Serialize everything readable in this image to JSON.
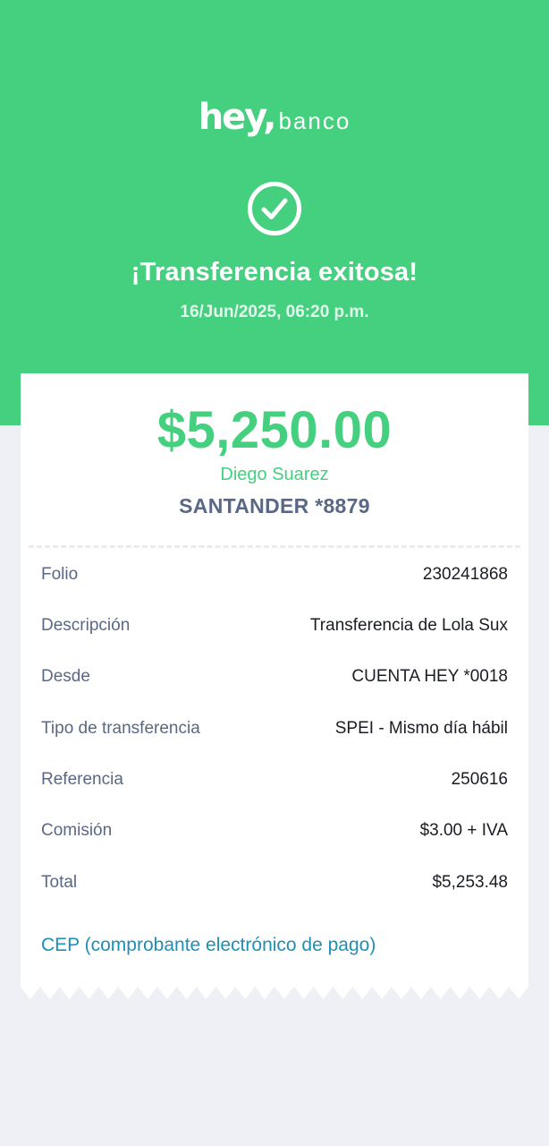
{
  "header": {
    "brand_main": "hey,",
    "brand_sub": "banco",
    "title": "¡Transferencia exitosa!",
    "datetime": "16/Jun/2025, 06:20 p.m.",
    "status_icon": "check-circle-icon",
    "bg_color": "#45d07f"
  },
  "receipt": {
    "amount": "$5,250.00",
    "recipient": "Diego Suarez",
    "bank": "SANTANDER *8879",
    "details": [
      {
        "label": "Folio",
        "value": "230241868"
      },
      {
        "label": "Descripción",
        "value": "Transferencia de Lola Sux"
      },
      {
        "label": "Desde",
        "value": "CUENTA HEY *0018"
      },
      {
        "label": "Tipo de transferencia",
        "value": "SPEI - Mismo día hábil"
      },
      {
        "label": "Referencia",
        "value": "250616"
      },
      {
        "label": "Comisión",
        "value": "$3.00 + IVA"
      },
      {
        "label": "Total",
        "value": "$5,253.48"
      }
    ],
    "cep_link": "CEP (comprobante electrónico de pago)"
  },
  "colors": {
    "accent": "#45d07f",
    "label": "#5a6885",
    "link": "#1f8fb5",
    "page_bg": "#eff0f5"
  }
}
